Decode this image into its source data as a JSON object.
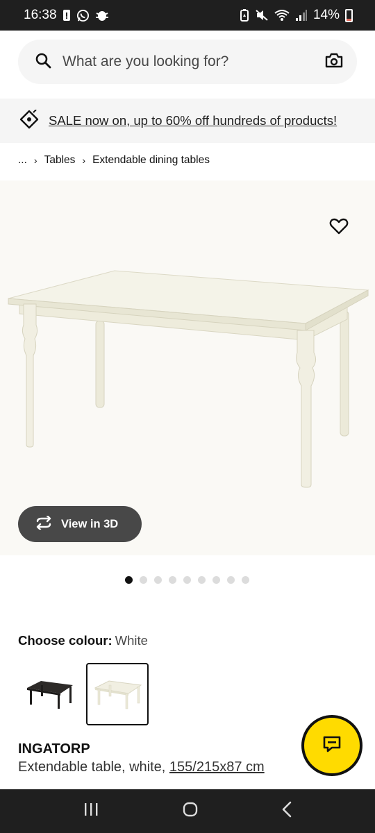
{
  "status_bar": {
    "time": "16:38",
    "battery_percent": "14%",
    "icons": [
      "lock-notification-icon",
      "whatsapp-icon",
      "bug-icon",
      "battery-saver-icon",
      "mute-icon",
      "wifi-icon",
      "signal-icon",
      "battery-icon"
    ]
  },
  "search": {
    "placeholder": "What are you looking for?",
    "left_icon": "search-icon",
    "right_icon": "camera-icon"
  },
  "banner": {
    "icon": "price-tag-icon",
    "text": "SALE now on, up to 60% off hundreds of products!"
  },
  "breadcrumb": {
    "items": [
      "...",
      "Tables",
      "Extendable dining tables"
    ]
  },
  "media": {
    "favourite_icon": "heart-icon",
    "view_3d_label": "View in 3D",
    "view_3d_icon": "rotate-icon",
    "image_count": 9,
    "active_image_index": 0
  },
  "colour": {
    "label": "Choose colour:",
    "value": "White",
    "options": [
      "black-table-swatch",
      "white-table-swatch"
    ],
    "selected_index": 1
  },
  "product": {
    "name": "INGATORP",
    "description": "Extendable table, white, ",
    "dimensions": "155/215x87 cm"
  },
  "chat": {
    "icon": "chat-icon",
    "color": "#ffdb00"
  },
  "nav": {
    "icons": [
      "recents-icon",
      "home-icon",
      "back-icon"
    ]
  },
  "colors": {
    "status_bar_bg": "#1f1f1f",
    "search_bg": "#f5f5f5",
    "button_dark": "#484848",
    "accent_yellow": "#ffdb00"
  }
}
